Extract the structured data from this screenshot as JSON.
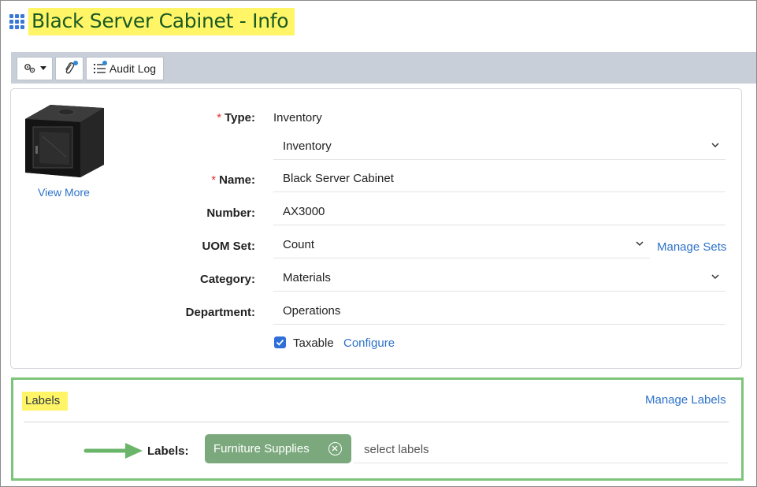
{
  "page": {
    "title": "Black Server Cabinet - Info"
  },
  "toolbar": {
    "settings_icon": "gears-icon",
    "attach_icon": "paperclip-icon",
    "audit_log_label": "Audit Log"
  },
  "item": {
    "image_alt": "server-cabinet",
    "view_more_label": "View More",
    "type": {
      "label": "Type:",
      "value": "Inventory",
      "select_value": "Inventory",
      "required": "*"
    },
    "name": {
      "label": "Name:",
      "value": "Black Server Cabinet",
      "required": "*"
    },
    "number": {
      "label": "Number:",
      "value": "AX3000"
    },
    "uom_set": {
      "label": "UOM Set:",
      "value": "Count",
      "manage_label": "Manage Sets"
    },
    "category": {
      "label": "Category:",
      "value": "Materials"
    },
    "department": {
      "label": "Department:",
      "value": "Operations"
    },
    "taxable": {
      "label": "Taxable",
      "checked": true,
      "configure_label": "Configure"
    }
  },
  "labels_section": {
    "title": "Labels",
    "manage_label": "Manage Labels",
    "field_label": "Labels:",
    "chips": [
      {
        "text": "Furniture Supplies"
      }
    ],
    "placeholder": "select labels"
  },
  "colors": {
    "accent": "#2d72c8",
    "highlight": "#fff566",
    "chip": "#7ba97d",
    "frame_green": "#7cc47a"
  }
}
